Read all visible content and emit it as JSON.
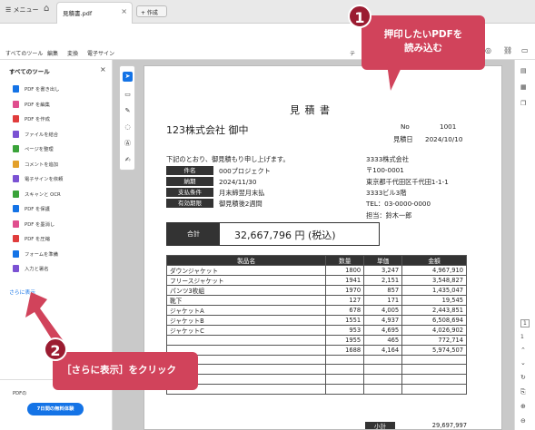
{
  "tabbar": {
    "menu": "☰ メニュー",
    "tab_title": "見積書.pdf",
    "new_tab": "+ 作成"
  },
  "nav": {
    "items": [
      "すべてのツール",
      "編集",
      "変換",
      "電子サイン"
    ],
    "right_cut": "テ"
  },
  "sidebar": {
    "title": "すべてのツール",
    "items": [
      {
        "label": "PDF を書き出し",
        "color": "#1473e6"
      },
      {
        "label": "PDF を編集",
        "color": "#e04e8e"
      },
      {
        "label": "PDF を作成",
        "color": "#e03c3c"
      },
      {
        "label": "ファイルを結合",
        "color": "#7b52d3"
      },
      {
        "label": "ページを整理",
        "color": "#3aa33a"
      },
      {
        "label": "コメントを追加",
        "color": "#e3a02a"
      },
      {
        "label": "電子サインを依頼",
        "color": "#7b52d3"
      },
      {
        "label": "スキャンと OCR",
        "color": "#3aa33a"
      },
      {
        "label": "PDF を保護",
        "color": "#1473e6"
      },
      {
        "label": "PDF を墨消し",
        "color": "#e04e8e"
      },
      {
        "label": "PDF を圧縮",
        "color": "#e03c3c"
      },
      {
        "label": "フォームを準備",
        "color": "#1473e6"
      },
      {
        "label": "入力と署名",
        "color": "#7b52d3"
      }
    ],
    "more": "さらに表示",
    "trial_text": "PDFの",
    "trial_button": "7日間の無料体験"
  },
  "doc": {
    "title": "見 積 書",
    "recipient": "123株式会社 御中",
    "no_label": "No",
    "no_value": "1001",
    "date_label": "見積日",
    "date_value": "2024/10/10",
    "intro": "下記のとおり、御見積もり申し上げます。",
    "info_rows": [
      {
        "label": "件名",
        "value": "000プロジェクト"
      },
      {
        "label": "納期",
        "value": "2024/11/30"
      },
      {
        "label": "支払条件",
        "value": "月末締翌月末払"
      },
      {
        "label": "有効期限",
        "value": "御見積後2週間"
      }
    ],
    "company": [
      "3333株式会社",
      "〒100-0001",
      "東京都千代田区千代田1-1-1",
      "3333ビル3階",
      "TEL：03-0000-0000",
      "担当：鈴木一郎"
    ],
    "total_label": "合計",
    "total_value": "32,667,796 円 (税込)",
    "table_headers": [
      "製品名",
      "数量",
      "単価",
      "金額"
    ],
    "rows": [
      [
        "ダウンジャケット",
        "1800",
        "3,247",
        "4,967,910"
      ],
      [
        "フリースジャケット",
        "1941",
        "2,151",
        "3,548,827"
      ],
      [
        "パンツ3枚組",
        "1970",
        "857",
        "1,435,047"
      ],
      [
        "靴下",
        "127",
        "171",
        "19,545"
      ],
      [
        "ジャケットA",
        "678",
        "4,005",
        "2,443,851"
      ],
      [
        "ジャケットB",
        "1551",
        "4,937",
        "6,508,694"
      ],
      [
        "ジャケットC",
        "953",
        "4,695",
        "4,026,902"
      ],
      [
        "",
        "1955",
        "465",
        "772,714"
      ],
      [
        "",
        "1688",
        "4,164",
        "5,974,507"
      ],
      [
        "",
        "",
        "",
        ""
      ],
      [
        "",
        "",
        "",
        ""
      ],
      [
        "",
        "",
        "",
        ""
      ],
      [
        "",
        "",
        "",
        ""
      ]
    ],
    "subtotal_label": "小計",
    "subtotal_value": "29,697,997"
  },
  "page_nav": {
    "current": "1",
    "total": "1"
  },
  "callout1": {
    "number": "1",
    "text_line1": "押印したいPDFを",
    "text_line2": "読み込む"
  },
  "callout2": {
    "number": "2",
    "text": "［さらに表示］をクリック"
  }
}
